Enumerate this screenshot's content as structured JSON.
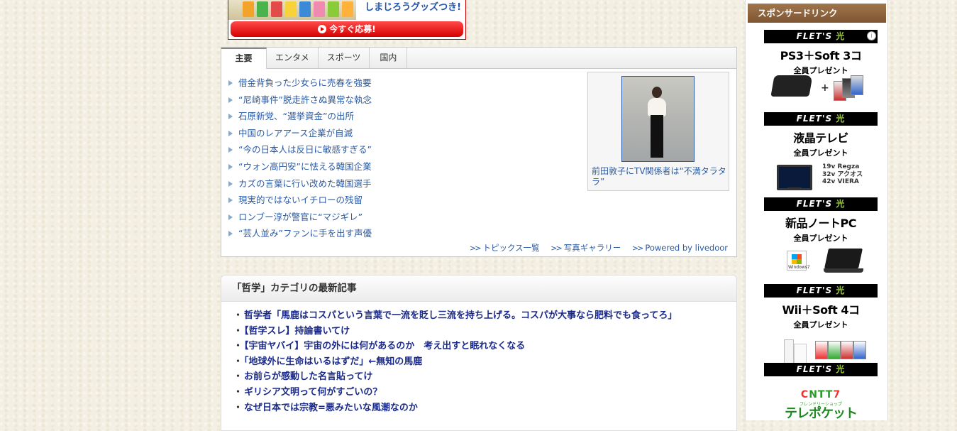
{
  "banner": {
    "tagline": "しまじろうグッズつき!",
    "cta_label": "今すぐ応募!"
  },
  "topics": {
    "tabs": [
      {
        "label": "主要",
        "active": true
      },
      {
        "label": "エンタメ",
        "active": false
      },
      {
        "label": "スポーツ",
        "active": false
      },
      {
        "label": "国内",
        "active": false
      }
    ],
    "items": [
      "借金背負った少女らに売春を強要",
      "“尼崎事件”脱走許さぬ異常な執念",
      "石原新党、“選挙資金”の出所",
      "中国のレアアース企業が自滅",
      "“今の日本人は反日に敏感すぎる”",
      "“ウォン高円安”に怯える韓国企業",
      "カズの言葉に行い改めた韓国選手",
      "現実的ではないイチローの残留",
      "ロンブー淳が警官に“マジギレ”",
      "“芸人並み”ファンに手を出す声優"
    ],
    "photo_caption": "前田敦子にTV関係者は“不満タラタラ”",
    "footer": {
      "list_link": "トピックス一覧",
      "gallery_link": "写真ギャラリー",
      "powered": "Powered by livedoor"
    }
  },
  "latest": {
    "heading": "「哲学」カテゴリの最新記事",
    "articles": [
      "哲学者「馬鹿はコスパという言葉で一流を貶し三流を持ち上げる。コスパが大事なら肥料でも食ってろ」",
      "【哲学スレ】持論書いてけ",
      "【宇宙ヤバイ】宇宙の外には何があるのか　考え出すと眠れなくなる",
      "「地球外に生命はいるはずだ」←無知の馬鹿",
      "お前らが感動した名言貼ってけ",
      "ギリシア文明って何がすごいの？",
      "なぜ日本では宗教=悪みたいな風潮なのか"
    ],
    "bullet": "・"
  },
  "sidebar": {
    "heading": "スポンサードリンク",
    "flets_text": "FLET'S",
    "flets_hikari": "光",
    "info_icon": "i",
    "ads": [
      {
        "title": "PS3＋Soft 3コ",
        "sub": "全員プレゼント"
      },
      {
        "title": "液晶テレビ",
        "sub": "全員プレゼント",
        "spec": [
          "19v Regza",
          "32v アクオス",
          "42v VIERA"
        ]
      },
      {
        "title": "新品ノートPC",
        "sub": "全員プレゼント",
        "badge": "Windows7"
      },
      {
        "title": "Wii＋Soft 4コ",
        "sub": "全員プレゼント"
      }
    ],
    "ntt": {
      "top": "NTT",
      "sub": "フレンドリーショップ",
      "logo": "テレポケット"
    }
  },
  "colors": {
    "link": "#2b5ba4",
    "article_link": "#1a2a8a",
    "sponsor_header": "#8b6038",
    "cta_red": "#e00000",
    "flets_green": "#9ccc33"
  }
}
